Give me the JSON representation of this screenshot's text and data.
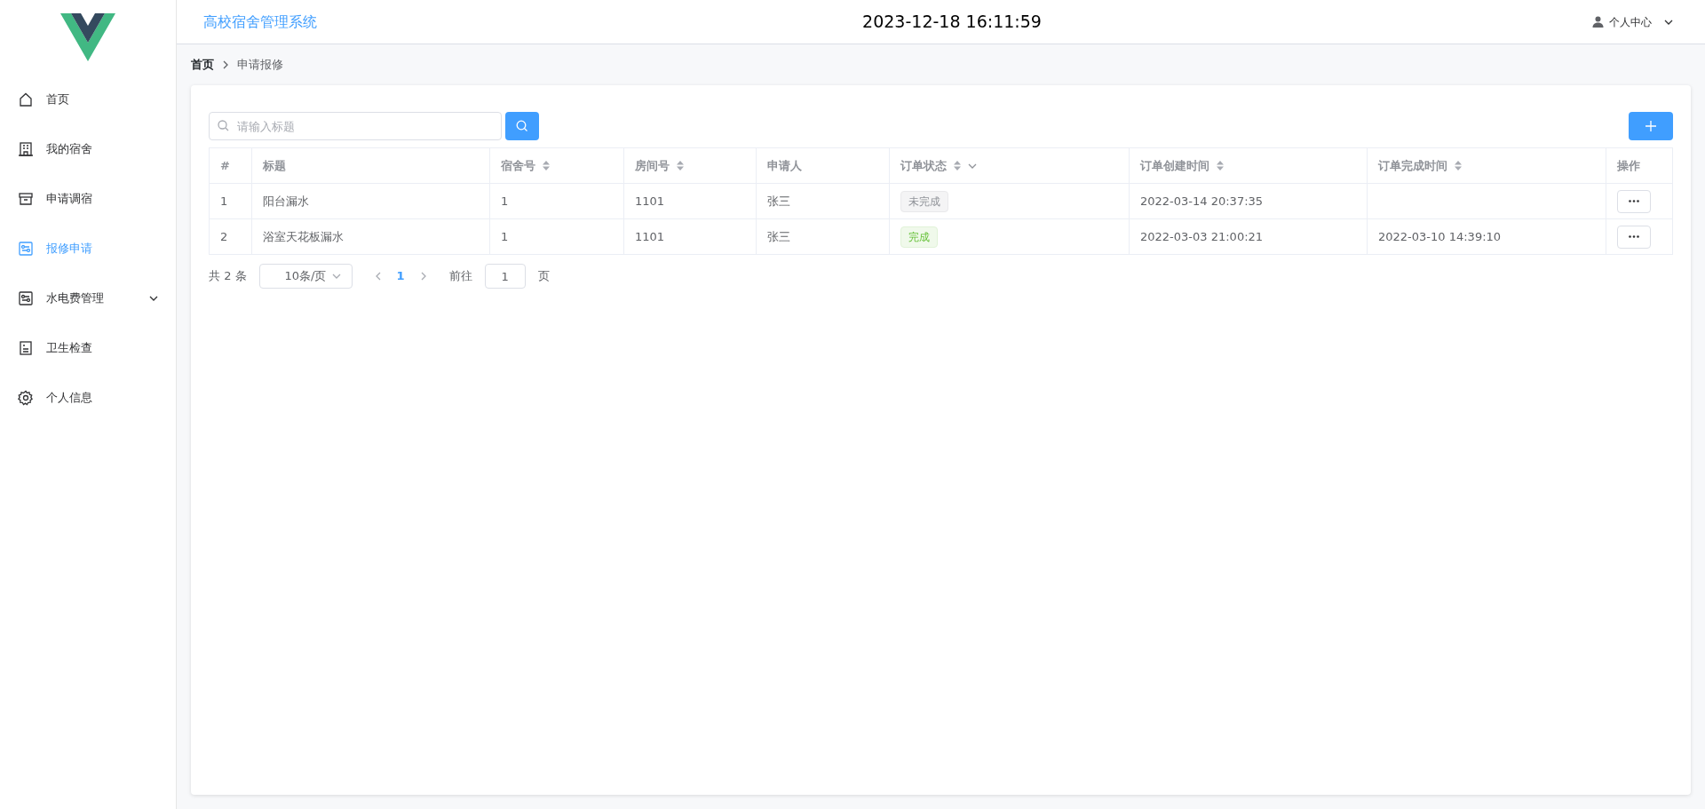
{
  "header": {
    "title": "高校宿舍管理系统",
    "clock": "2023-12-18 16:11:59",
    "user_menu": "个人中心"
  },
  "sidebar": {
    "items": [
      {
        "label": "首页",
        "selected": false,
        "expandable": false
      },
      {
        "label": "我的宿舍",
        "selected": false,
        "expandable": false
      },
      {
        "label": "申请调宿",
        "selected": false,
        "expandable": false
      },
      {
        "label": "报修申请",
        "selected": true,
        "expandable": false
      },
      {
        "label": "水电费管理",
        "selected": false,
        "expandable": true
      },
      {
        "label": "卫生检查",
        "selected": false,
        "expandable": false
      },
      {
        "label": "个人信息",
        "selected": false,
        "expandable": false
      }
    ]
  },
  "breadcrumb": [
    "首页",
    "申请报修"
  ],
  "search": {
    "placeholder": "请输入标题"
  },
  "table": {
    "columns": [
      {
        "label": "#",
        "sortable": false,
        "filter": false
      },
      {
        "label": "标题",
        "sortable": false,
        "filter": false
      },
      {
        "label": "宿舍号",
        "sortable": true,
        "filter": false
      },
      {
        "label": "房间号",
        "sortable": true,
        "filter": false
      },
      {
        "label": "申请人",
        "sortable": false,
        "filter": false
      },
      {
        "label": "订单状态",
        "sortable": true,
        "filter": true
      },
      {
        "label": "订单创建时间",
        "sortable": true,
        "filter": false
      },
      {
        "label": "订单完成时间",
        "sortable": true,
        "filter": false
      },
      {
        "label": "操作",
        "sortable": false,
        "filter": false
      }
    ],
    "rows": [
      {
        "index": "1",
        "title": "阳台漏水",
        "dorm": "1",
        "room": "1101",
        "applicant": "张三",
        "status": {
          "text": "未完成",
          "kind": "pending"
        },
        "created": "2022-03-14 20:37:35",
        "finished": null
      },
      {
        "index": "2",
        "title": "浴室天花板漏水",
        "dorm": "1",
        "room": "1101",
        "applicant": "张三",
        "status": {
          "text": "完成",
          "kind": "done"
        },
        "created": "2022-03-03 21:00:21",
        "finished": "2022-03-10 14:39:10"
      }
    ]
  },
  "pagination": {
    "total": "共 2 条",
    "page_size": "10条/页",
    "pages": [
      {
        "label": "1",
        "selected": true
      }
    ],
    "goto_label": "前往",
    "goto_value": "1",
    "goto_suffix": "页"
  }
}
